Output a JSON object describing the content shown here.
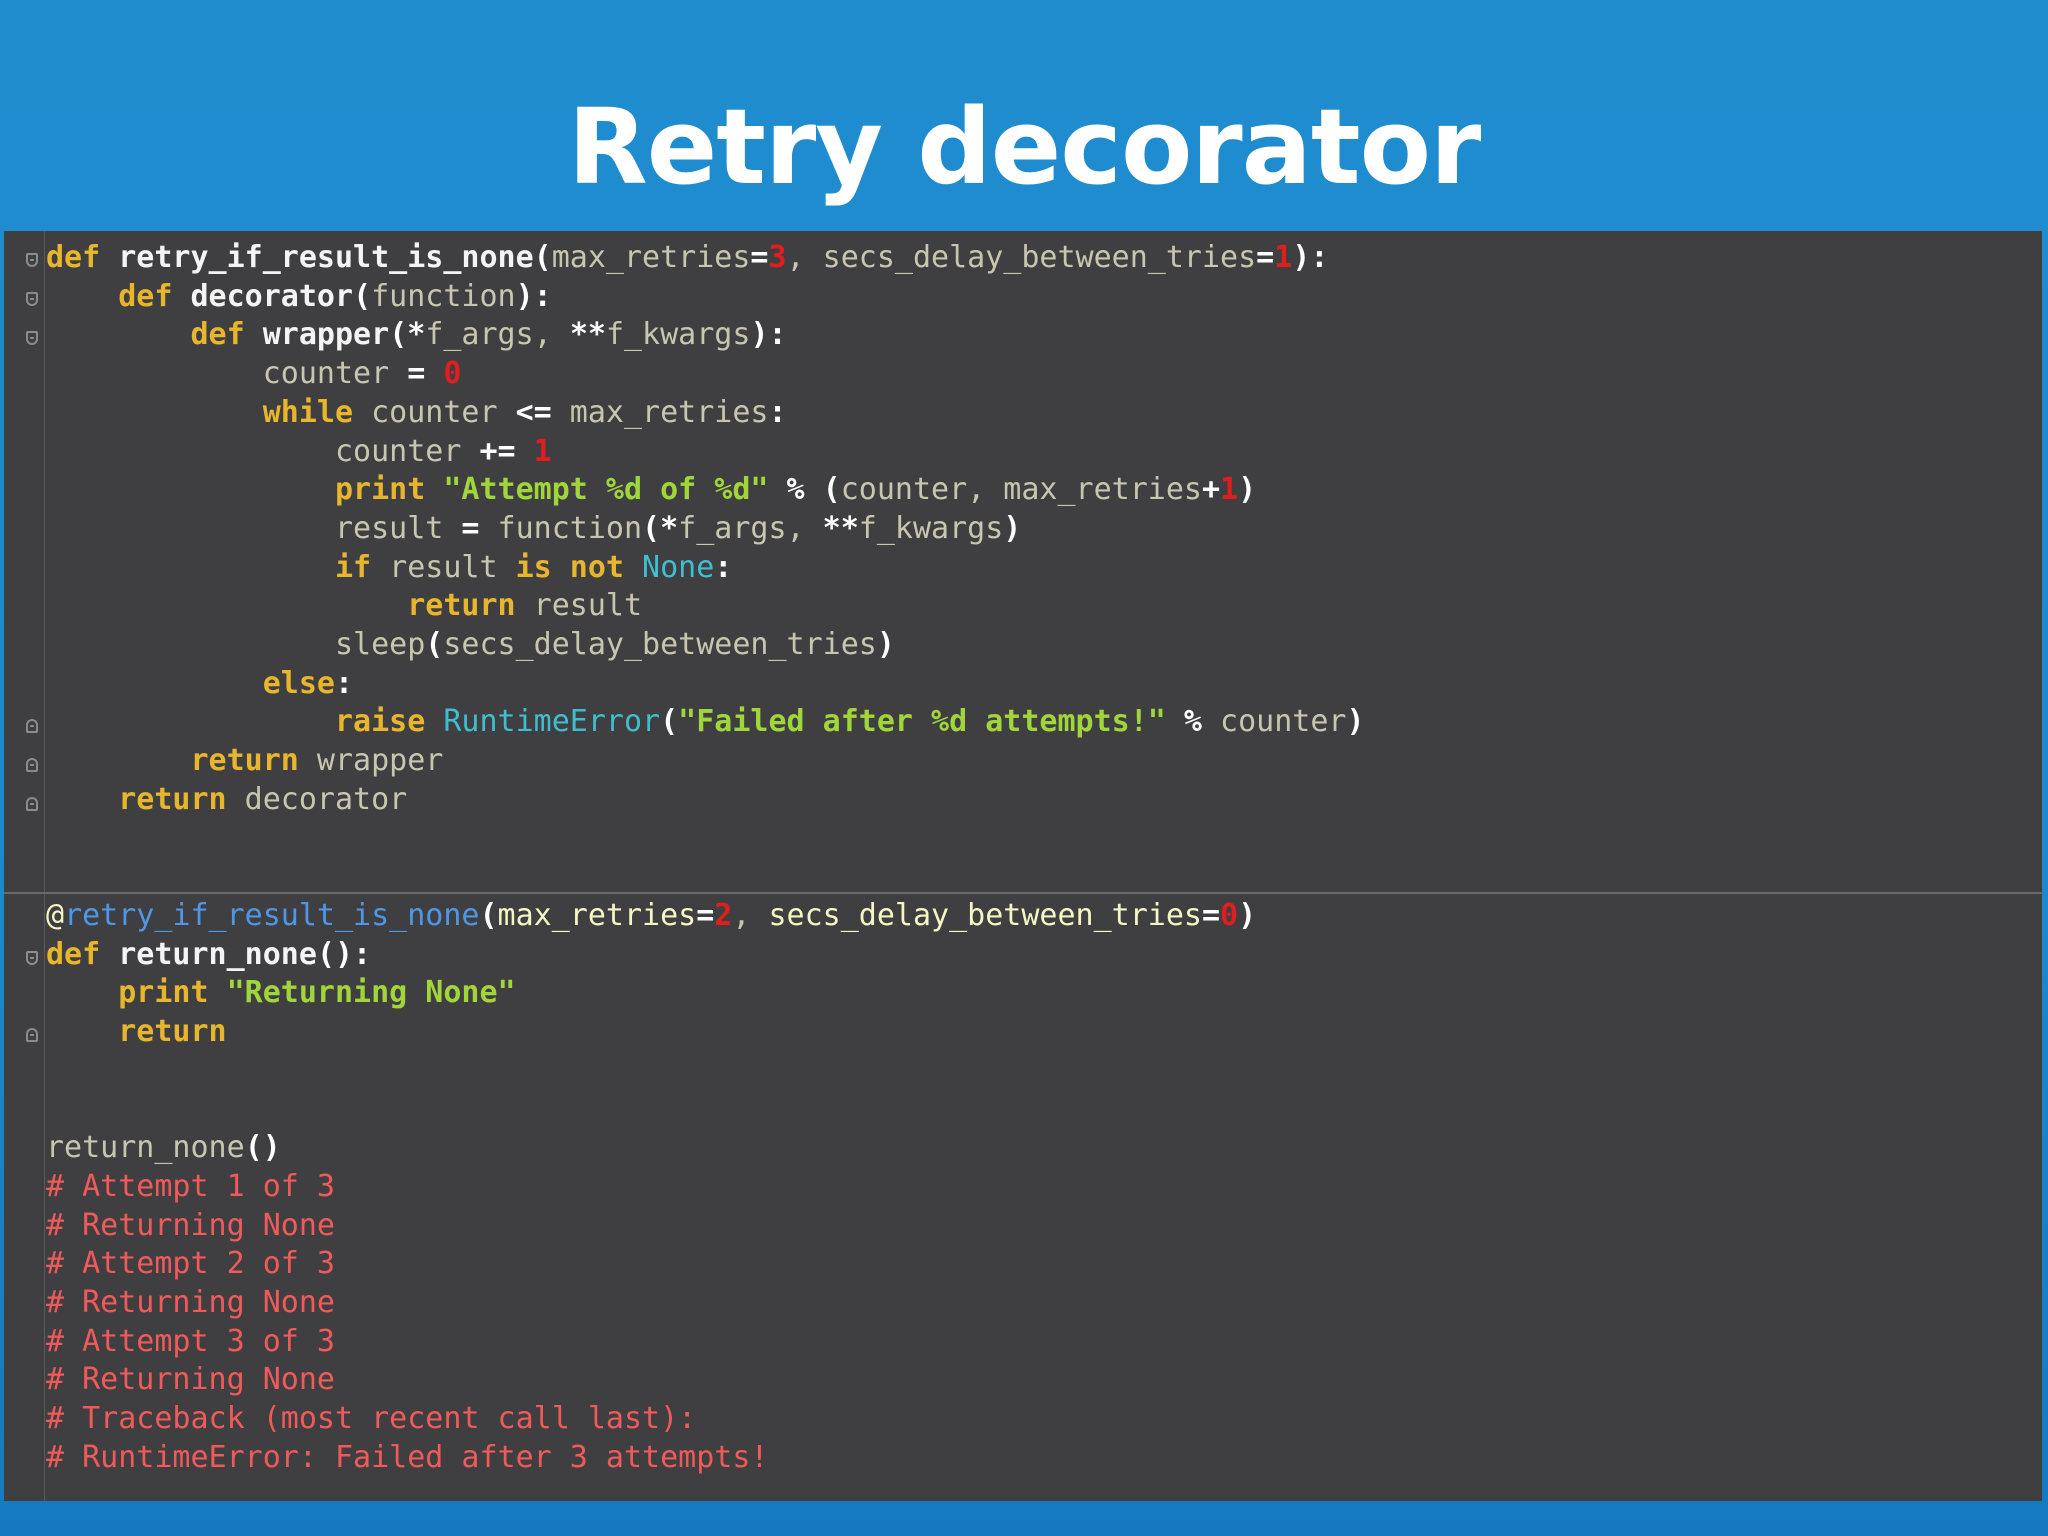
{
  "slide": {
    "title": "Retry decorator"
  },
  "code": {
    "lines": [
      [
        [
          "def",
          "kw"
        ],
        [
          " ",
          "pl"
        ],
        [
          "retry_if_result_is_none",
          "fn"
        ],
        [
          "(",
          "op"
        ],
        [
          "max_retries",
          "pl"
        ],
        [
          "=",
          "op"
        ],
        [
          "3",
          "num"
        ],
        [
          ", ",
          "pl"
        ],
        [
          "secs_delay_between_tries",
          "pl"
        ],
        [
          "=",
          "op"
        ],
        [
          "1",
          "num"
        ],
        [
          "):",
          "op"
        ]
      ],
      [
        [
          "    ",
          "pl"
        ],
        [
          "def",
          "kw"
        ],
        [
          " ",
          "pl"
        ],
        [
          "decorator",
          "fn"
        ],
        [
          "(",
          "op"
        ],
        [
          "function",
          "pl"
        ],
        [
          "):",
          "op"
        ]
      ],
      [
        [
          "        ",
          "pl"
        ],
        [
          "def",
          "kw"
        ],
        [
          " ",
          "pl"
        ],
        [
          "wrapper",
          "fn"
        ],
        [
          "(",
          "op"
        ],
        [
          "*",
          "op"
        ],
        [
          "f_args",
          "pl"
        ],
        [
          ", ",
          "pl"
        ],
        [
          "**",
          "op"
        ],
        [
          "f_kwargs",
          "pl"
        ],
        [
          "):",
          "op"
        ]
      ],
      [
        [
          "            ",
          "pl"
        ],
        [
          "counter",
          "pl"
        ],
        [
          " ",
          "pl"
        ],
        [
          "=",
          "op"
        ],
        [
          " ",
          "pl"
        ],
        [
          "0",
          "num"
        ]
      ],
      [
        [
          "            ",
          "pl"
        ],
        [
          "while",
          "kw"
        ],
        [
          " counter ",
          "pl"
        ],
        [
          "<=",
          "op"
        ],
        [
          " max_retries",
          "pl"
        ],
        [
          ":",
          "op"
        ]
      ],
      [
        [
          "                ",
          "pl"
        ],
        [
          "counter",
          "pl"
        ],
        [
          " ",
          "pl"
        ],
        [
          "+=",
          "op"
        ],
        [
          " ",
          "pl"
        ],
        [
          "1",
          "num"
        ]
      ],
      [
        [
          "                ",
          "pl"
        ],
        [
          "print",
          "kw"
        ],
        [
          " ",
          "pl"
        ],
        [
          "\"Attempt %d of %d\"",
          "str"
        ],
        [
          " ",
          "pl"
        ],
        [
          "%",
          "op"
        ],
        [
          " ",
          "pl"
        ],
        [
          "(",
          "op"
        ],
        [
          "counter, max_retries",
          "pl"
        ],
        [
          "+",
          "op"
        ],
        [
          "1",
          "num"
        ],
        [
          ")",
          "op"
        ]
      ],
      [
        [
          "                ",
          "pl"
        ],
        [
          "result",
          "pl"
        ],
        [
          " ",
          "pl"
        ],
        [
          "=",
          "op"
        ],
        [
          " function",
          "pl"
        ],
        [
          "(",
          "op"
        ],
        [
          "*",
          "op"
        ],
        [
          "f_args, ",
          "pl"
        ],
        [
          "**",
          "op"
        ],
        [
          "f_kwargs",
          "pl"
        ],
        [
          ")",
          "op"
        ]
      ],
      [
        [
          "                ",
          "pl"
        ],
        [
          "if",
          "kw"
        ],
        [
          " result ",
          "pl"
        ],
        [
          "is",
          "kw"
        ],
        [
          " ",
          "pl"
        ],
        [
          "not",
          "kw"
        ],
        [
          " ",
          "pl"
        ],
        [
          "None",
          "bi"
        ],
        [
          ":",
          "op"
        ]
      ],
      [
        [
          "                    ",
          "pl"
        ],
        [
          "return",
          "kw"
        ],
        [
          " result",
          "pl"
        ]
      ],
      [
        [
          "                ",
          "pl"
        ],
        [
          "sleep",
          "pl"
        ],
        [
          "(",
          "op"
        ],
        [
          "secs_delay_between_tries",
          "pl"
        ],
        [
          ")",
          "op"
        ]
      ],
      [
        [
          "            ",
          "pl"
        ],
        [
          "else",
          "kw"
        ],
        [
          ":",
          "op"
        ]
      ],
      [
        [
          "                ",
          "pl"
        ],
        [
          "raise",
          "kw"
        ],
        [
          " ",
          "pl"
        ],
        [
          "RuntimeError",
          "bi"
        ],
        [
          "(",
          "op"
        ],
        [
          "\"Failed after %d attempts!\"",
          "str"
        ],
        [
          " ",
          "pl"
        ],
        [
          "%",
          "op"
        ],
        [
          " counter",
          "pl"
        ],
        [
          ")",
          "op"
        ]
      ],
      [
        [
          "        ",
          "pl"
        ],
        [
          "return",
          "kw"
        ],
        [
          " wrapper",
          "pl"
        ]
      ],
      [
        [
          "    ",
          "pl"
        ],
        [
          "return",
          "kw"
        ],
        [
          " decorator",
          "pl"
        ]
      ],
      [],
      [],
      [
        [
          "@",
          "decp"
        ],
        [
          "retry_if_result_is_none",
          "dec"
        ],
        [
          "(",
          "op"
        ],
        [
          "max_retries",
          "decp"
        ],
        [
          "=",
          "op"
        ],
        [
          "2",
          "num"
        ],
        [
          ", ",
          "pl"
        ],
        [
          "secs_delay_between_tries",
          "decp"
        ],
        [
          "=",
          "op"
        ],
        [
          "0",
          "num"
        ],
        [
          ")",
          "op"
        ]
      ],
      [
        [
          "def",
          "kw"
        ],
        [
          " ",
          "pl"
        ],
        [
          "return_none",
          "fn"
        ],
        [
          "():",
          "op"
        ]
      ],
      [
        [
          "    ",
          "pl"
        ],
        [
          "print",
          "kw"
        ],
        [
          " ",
          "pl"
        ],
        [
          "\"Returning None\"",
          "str"
        ]
      ],
      [
        [
          "    ",
          "pl"
        ],
        [
          "return",
          "kw"
        ]
      ],
      [],
      [],
      [
        [
          "return_none",
          "pl"
        ],
        [
          "()",
          "op"
        ]
      ],
      [
        [
          "# Attempt 1 of 3",
          "cmt"
        ]
      ],
      [
        [
          "# Returning None",
          "cmt"
        ]
      ],
      [
        [
          "# Attempt 2 of 3",
          "cmt"
        ]
      ],
      [
        [
          "# Returning None",
          "cmt"
        ]
      ],
      [
        [
          "# Attempt 3 of 3",
          "cmt"
        ]
      ],
      [
        [
          "# Returning None",
          "cmt"
        ]
      ],
      [
        [
          "# Traceback (most recent call last):",
          "cmt"
        ]
      ],
      [
        [
          "# RuntimeError: Failed after 3 attempts!",
          "cmt"
        ]
      ]
    ]
  }
}
